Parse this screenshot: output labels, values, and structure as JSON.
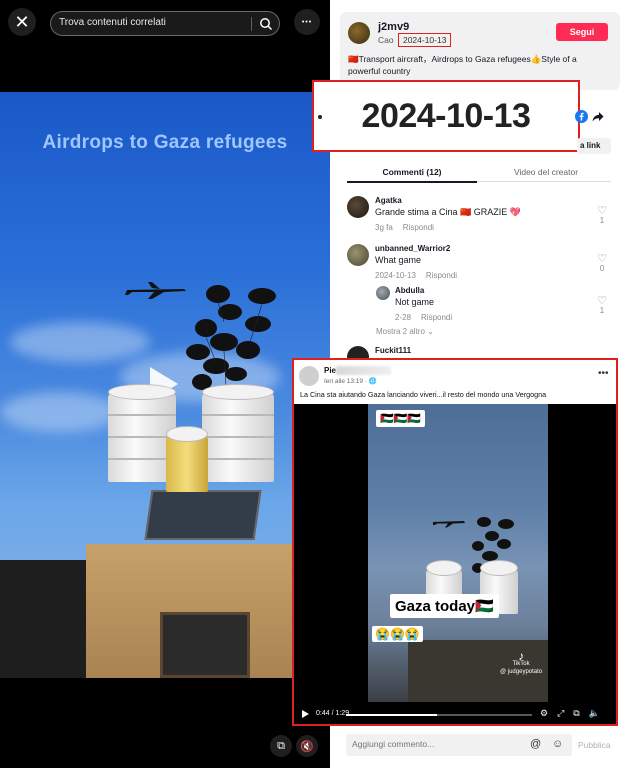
{
  "header": {
    "search_placeholder": "Trova contenuti correlati",
    "close_glyph": "✕",
    "more_glyph": "•••"
  },
  "video": {
    "overlay_caption": "Airdrops to Gaza refugees"
  },
  "creator": {
    "username": "j2mv9",
    "display_name": "Cao",
    "date": "2024-10-13",
    "follow_label": "Segui",
    "caption": "🇨🇳Transport aircraft，Airdrops to Gaza refugees👍Style of a powerful country"
  },
  "zoom_callout": {
    "date": "2024-10-13"
  },
  "share": {
    "copy_link_label": "a link"
  },
  "tabs": {
    "comments": "Commenti (12)",
    "creator_videos": "Video del creator"
  },
  "comments": [
    {
      "user": "Agatka",
      "text": "Grande stima a Cina 🇨🇳 GRAZIE 💖",
      "time": "3g fa",
      "reply": "Rispondi",
      "likes": "1"
    },
    {
      "user": "unbanned_Warrior2",
      "text": "What game",
      "time": "2024-10-13",
      "reply": "Rispondi",
      "likes": "0"
    },
    {
      "user": "Abdulla",
      "text": "Not game",
      "time": "2-28",
      "reply": "Rispondi",
      "likes": "1"
    },
    {
      "user": "Fuckit111",
      "text": "",
      "time": "",
      "reply": "",
      "likes": ""
    }
  ],
  "more_replies": "Mostra 2 altro",
  "comment_bar": {
    "placeholder": "Aggiungi commento...",
    "publish": "Pubblica"
  },
  "fb_post": {
    "name": "Pie",
    "time": "Ieri alle 13:19 · 🌐",
    "text": "La Cina sta aiutando Gaza lanciando viveri...il resto del mondo una Vergogna",
    "flags": "🇵🇸🇵🇸🇵🇸",
    "overlay_title": "Gaza today🇵🇸",
    "overlay_emoji": "😭😭😭",
    "watermark_brand": "TikTok",
    "watermark_handle": "@ judgeypotato",
    "timecode": "0:44 / 1:29",
    "progress": 0.49
  },
  "colors": {
    "follow": "#fe2c55",
    "highlight": "#e02020"
  }
}
